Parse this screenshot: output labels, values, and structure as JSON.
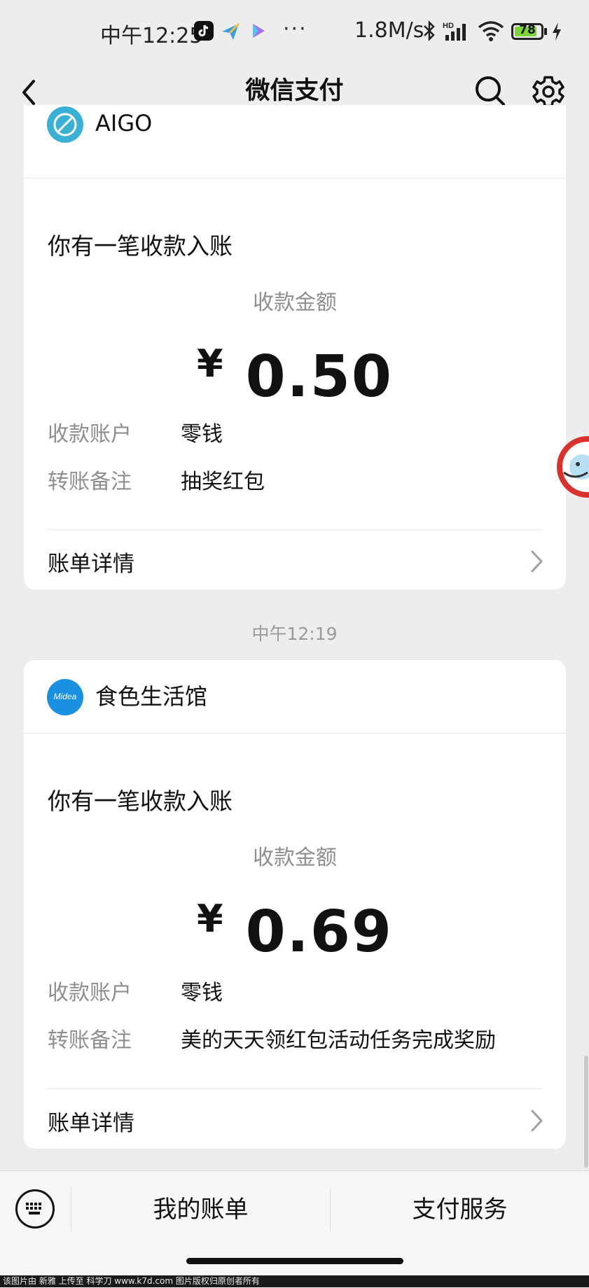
{
  "status_bar": {
    "time": "中午12:25",
    "more": "···",
    "network_speed": "1.8M/s",
    "signal_label": "HD",
    "battery_level": "78"
  },
  "nav": {
    "title": "微信支付"
  },
  "timestamp": "中午12:19",
  "cards": [
    {
      "merchant": "AIGO",
      "notice": "你有一笔收款入账",
      "amount_label": "收款金额",
      "currency": "¥",
      "amount": "0.50",
      "account_label": "收款账户",
      "account_value": "零钱",
      "remark_label": "转账备注",
      "remark_value": "抽奖红包",
      "detail_label": "账单详情"
    },
    {
      "merchant": "食色生活馆",
      "notice": "你有一笔收款入账",
      "amount_label": "收款金额",
      "currency": "¥",
      "amount": "0.69",
      "account_label": "收款账户",
      "account_value": "零钱",
      "remark_label": "转账备注",
      "remark_value": "美的天天领红包活动任务完成奖励",
      "detail_label": "账单详情",
      "logo_text": "Midea"
    }
  ],
  "bottom_bar": {
    "my_bill": "我的账单",
    "pay_service": "支付服务"
  },
  "watermark": "该图片由 新雅 上传至 科学刀 www.k7d.com 图片版权归原创者所有",
  "colors": {
    "background": "#ededed",
    "card": "#ffffff",
    "aigo_logo": "#3ab0d4",
    "midea_logo": "#1a90e0",
    "muted_text": "#8e8e8e"
  }
}
